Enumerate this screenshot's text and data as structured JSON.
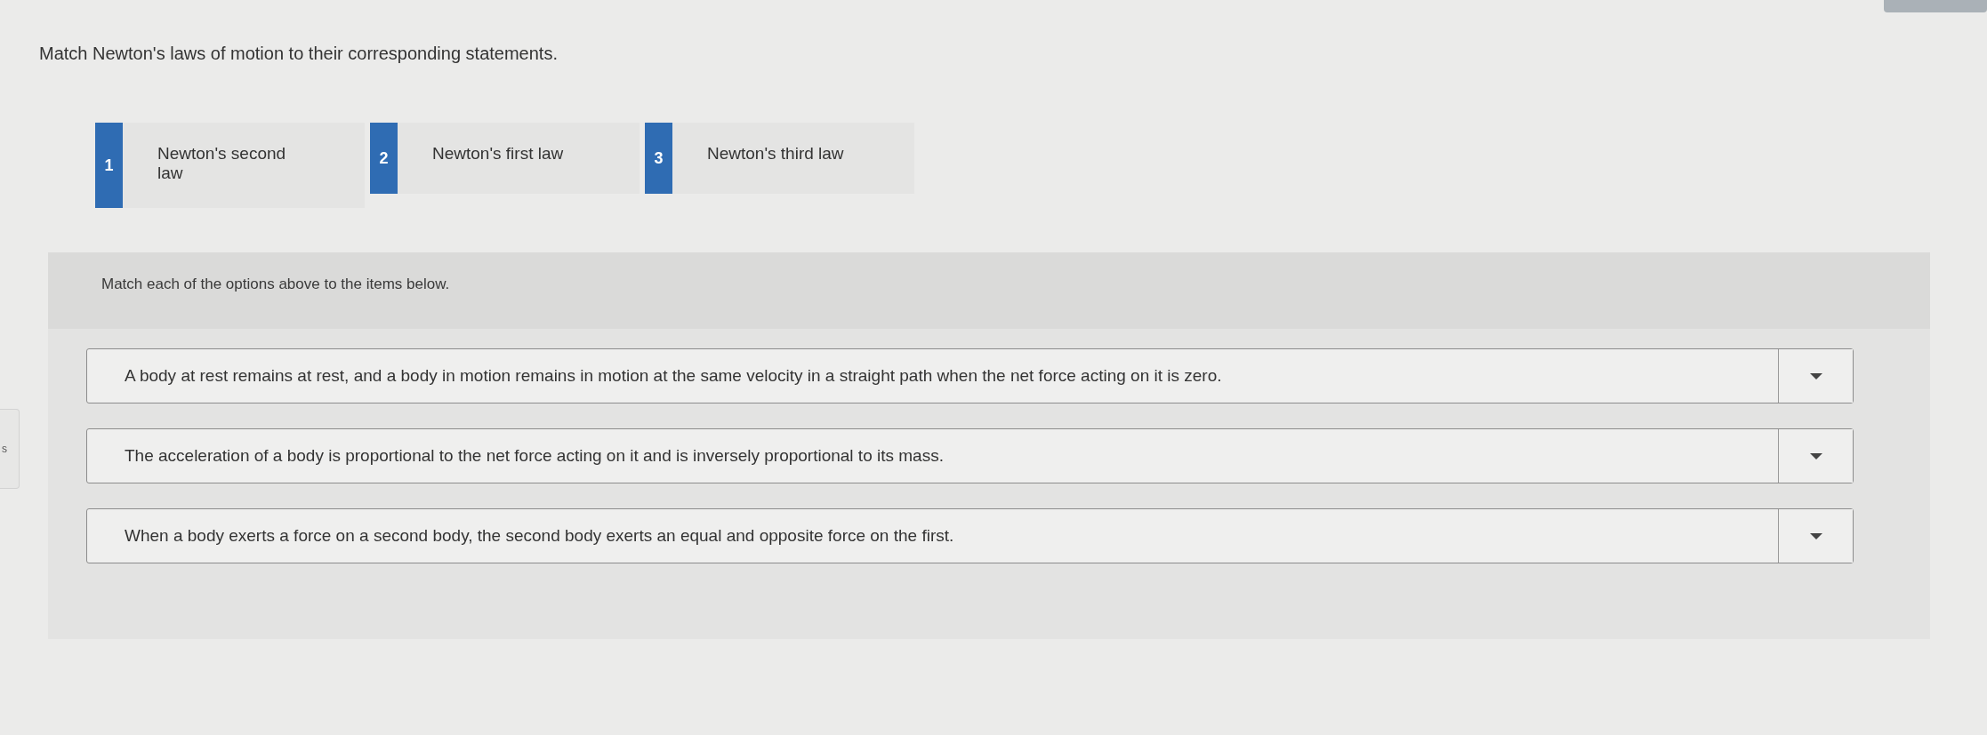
{
  "question": "Match Newton's laws of motion to their corresponding statements.",
  "options": [
    {
      "number": "1",
      "label": "Newton's second law"
    },
    {
      "number": "2",
      "label": "Newton's first law"
    },
    {
      "number": "3",
      "label": "Newton's third law"
    }
  ],
  "match_panel": {
    "instruction": "Match each of the options above to the items below.",
    "items": [
      {
        "statement": "A body at rest remains at rest, and a body in motion remains in motion at the same velocity in a straight path when the net force acting on it is zero."
      },
      {
        "statement": "The acceleration of a body is proportional to the net force acting on it and is inversely proportional to its mass."
      },
      {
        "statement": "When a body exerts a force on a second body, the second body exerts an equal and opposite force on the first."
      }
    ]
  },
  "side_tab": {
    "text": "s"
  }
}
